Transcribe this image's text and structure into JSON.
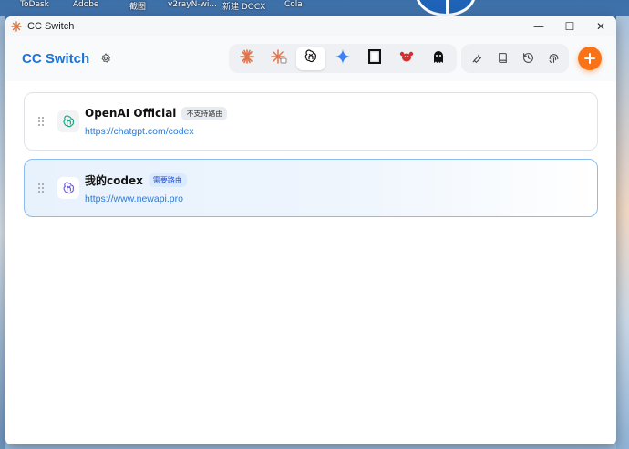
{
  "desktop": {
    "icons": [
      "ToDesk",
      "Adobe",
      "截图",
      "v2rayN-wi...",
      "新建 DOCX",
      "Cola"
    ]
  },
  "window": {
    "title": "CC Switch",
    "minimize_glyph": "—",
    "maximize_glyph": "☐",
    "close_glyph": "✕"
  },
  "header": {
    "brand": "CC Switch",
    "apps": [
      {
        "name": "claude",
        "icon": "claude-burst-icon",
        "color": "#e0734a",
        "active": false
      },
      {
        "name": "claude-desktop",
        "icon": "claude-burst-badge-icon",
        "color": "#e0734a",
        "active": false
      },
      {
        "name": "codex",
        "icon": "openai-icon",
        "color": "#111111",
        "active": true
      },
      {
        "name": "gemini",
        "icon": "gemini-sparkle-icon",
        "color": "#3b82f6",
        "active": false
      },
      {
        "name": "opencode",
        "icon": "square-outline-icon",
        "color": "#111111",
        "active": false
      },
      {
        "name": "openclaw",
        "icon": "lobster-icon",
        "color": "#d32f2f",
        "active": false
      },
      {
        "name": "other",
        "icon": "ghost-icon",
        "color": "#111111",
        "active": false
      }
    ],
    "tools": [
      {
        "name": "wrench",
        "icon": "wrench-icon"
      },
      {
        "name": "book",
        "icon": "book-icon"
      },
      {
        "name": "history",
        "icon": "history-icon"
      },
      {
        "name": "mcp",
        "icon": "fingerprint-icon"
      }
    ],
    "accent": "#f97316"
  },
  "providers": [
    {
      "name": "OpenAI Official",
      "badge": "不支持路由",
      "url": "https://chatgpt.com/codex",
      "active": false,
      "logo_color": "#10a37f"
    },
    {
      "name": "我的codex",
      "badge": "需要路由",
      "url": "https://www.newapi.pro",
      "active": true,
      "logo_color": "#6b5bd6"
    }
  ]
}
